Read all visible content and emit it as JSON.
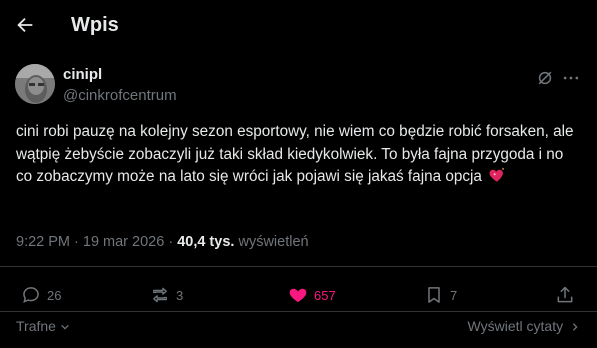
{
  "header": {
    "title": "Wpis",
    "back_icon": "arrow-left-icon"
  },
  "post": {
    "display_name": "cinipl",
    "handle": "@cinkrofcentrum",
    "text": "cini robi pauzę na kolejny sezon esportowy, nie wiem co będzie robić forsaken, ale wątpię żebyście zobaczyli już taki skład kiedykolwiek. To była fajna przygoda i no co zobaczymy może na lato się wróci jak pojawi się jakaś fajna opcja",
    "emoji": "sparkling-heart-icon",
    "time": "9:22 PM · 19 mar 2026 · ",
    "views_count": "40,4 tys.",
    "views_label": " wyświetleń"
  },
  "actions": {
    "replies": "26",
    "reposts": "3",
    "likes": "657",
    "bookmarks": "7"
  },
  "footer": {
    "sort": "Trafne",
    "quotes": "Wyświetl cytaty"
  },
  "colors": {
    "background": "#000000",
    "text": "#e7e9ea",
    "muted": "#71767b",
    "like": "#f91880",
    "divider": "#2f3336"
  }
}
